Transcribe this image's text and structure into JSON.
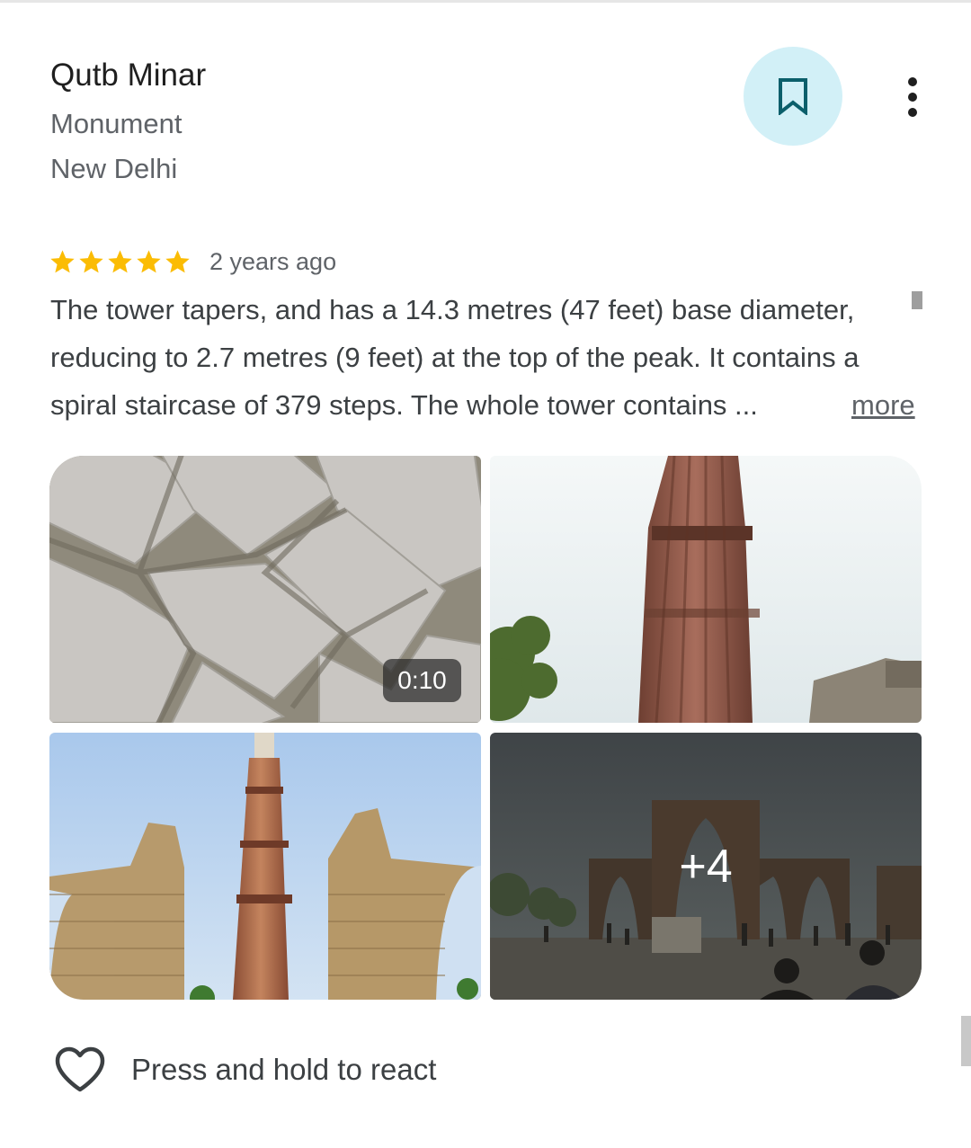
{
  "place": {
    "name": "Qutb Minar",
    "type": "Monument",
    "city": "New Delhi"
  },
  "actions": {
    "save_icon": "bookmark-icon",
    "more_icon": "more-vert-icon"
  },
  "review": {
    "rating": 5,
    "rating_max": 5,
    "time_ago": "2 years ago",
    "text": "The tower tapers, and has a 14.3 metres (47 feet) base diameter, reducing to 2.7 metres (9 feet) at the top of the peak. It contains a spiral staircase of 379 steps. The whole tower contains ...",
    "more_label": "more"
  },
  "photos": [
    {
      "kind": "video",
      "duration": "0:10"
    },
    {
      "kind": "image"
    },
    {
      "kind": "image"
    },
    {
      "kind": "image",
      "more_count_label": "+4"
    }
  ],
  "reaction": {
    "label": "Press and hold to react",
    "icon": "heart-outline-icon"
  },
  "colors": {
    "save_button_bg": "#d2f0f7",
    "save_icon": "#0b5f6b",
    "star": "#fbbc04",
    "secondary_text": "#5f6368"
  }
}
